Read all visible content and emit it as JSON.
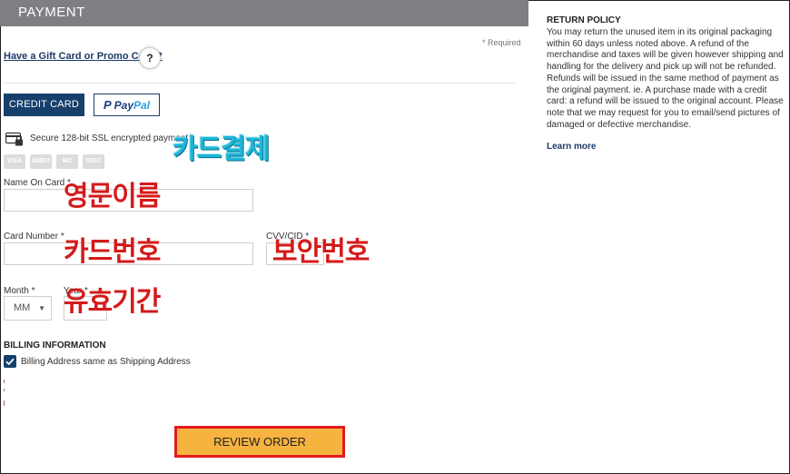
{
  "payment": {
    "header": "PAYMENT",
    "required_note": "* Required",
    "gift_link": "Have a Gift Card or Promo Code?",
    "help_label": "?",
    "credit_card_button": "CREDIT CARD",
    "paypal": {
      "p": "P",
      "pay": "Pay",
      "pal": "Pal"
    },
    "secure_text": "Secure 128-bit SSL encrypted payment",
    "card_logos": [
      "VISA",
      "AMEX",
      "MC",
      "DISC"
    ],
    "name_label": "Name On Card",
    "card_number_label": "Card Number",
    "cvv_label": "CVV/CID",
    "month_label": "Month",
    "month_value": "MM",
    "year_label": "Year",
    "asterisk": "*",
    "billing_title": "BILLING INFORMATION",
    "billing_checkbox_label": "Billing Address same as Shipping Address",
    "review_button": "REVIEW ORDER"
  },
  "annotations": {
    "card_payment": "카드결제",
    "english_name": "영문이름",
    "card_number": "카드번호",
    "security_code": "보안번호",
    "expiry": "유효기간"
  },
  "policy": {
    "title": "RETURN POLICY",
    "text": "You may return the unused item in its original packaging within 60 days unless noted above. A refund of the merchandise and taxes will be given however shipping and handling for the delivery and pick up will not be refunded. Refunds will be issued in the same method of payment as the original payment. ie. A purchase made with a credit card: a refund will be issued to the original account. Please note that we may request for you to email/send pictures of damaged or defective merchandise.",
    "learn_more": "Learn more"
  },
  "colors": {
    "header_bg": "#7d7f82",
    "primary_navy": "#173f6b",
    "review_orange": "#f6b340",
    "highlight_red": "#e21b1b",
    "annotation_red": "#d51a1a",
    "annotation_cyan": "#1fb6d9"
  },
  "icons": [
    "lock-card-icon",
    "question-icon",
    "checkmark-icon",
    "chevron-down-icon",
    "paypal-logo-icon"
  ]
}
